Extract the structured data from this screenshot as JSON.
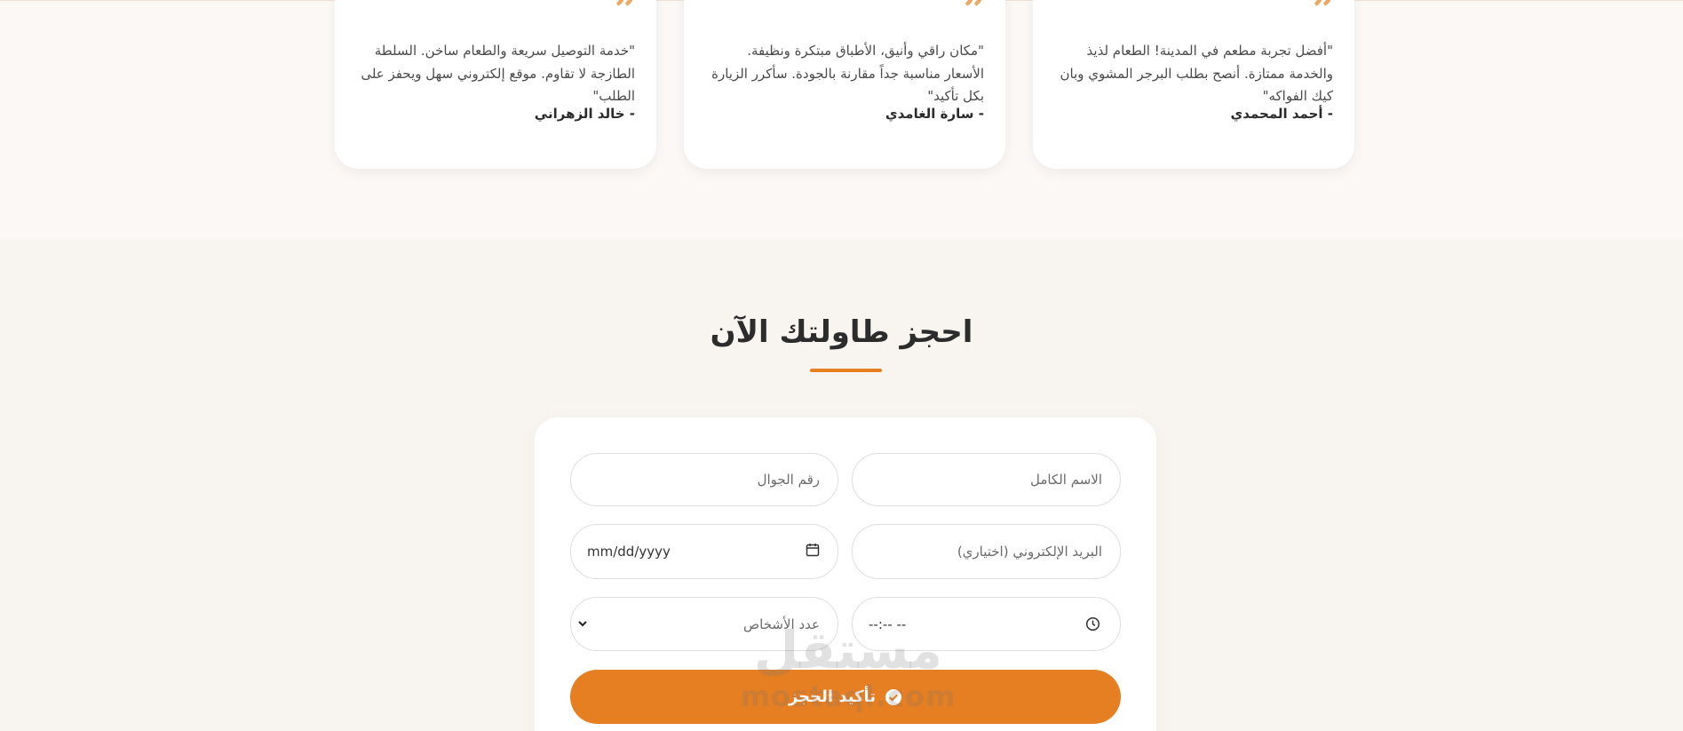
{
  "testimonials": [
    {
      "text": "\"أفضل تجربة مطعم في المدينة! الطعام لذيذ والخدمة ممتازة. أنصح بطلب البرجر المشوي وبان كيك الفواكه\"",
      "author": "- أحمد المحمدي"
    },
    {
      "text": "\"مكان راقي وأنيق، الأطباق مبتكرة ونظيفة. الأسعار مناسبة جداً مقارنة بالجودة. سأكرر الزيارة بكل تأكيد\"",
      "author": "- سارة الغامدي"
    },
    {
      "text": "\"خدمة التوصيل سريعة والطعام ساخن. السلطة الطازجة لا تقاوم. موقع إلكتروني سهل ويحفز على الطلب\"",
      "author": "- خالد الزهراني"
    }
  ],
  "booking": {
    "title": "احجز طاولتك الآن",
    "fields": {
      "full_name": "الاسم الكامل",
      "phone": "رقم الجوال",
      "email": "البريد الإلكتروني (اختياري)",
      "date": "mm/dd/yyyy",
      "time": "--:-- --",
      "people": "عدد الأشخاص"
    },
    "submit_label": "تأكيد الحجز"
  },
  "watermark": {
    "arabic": "مستقل",
    "latin": "mostaql.com"
  },
  "colors": {
    "accent": "#e67e22",
    "quote": "#e9a964",
    "background": "#f8f4ef"
  },
  "icons": {
    "quote": "quote-icon",
    "calendar": "calendar-icon",
    "clock": "clock-icon",
    "chevron": "chevron-down-icon",
    "check": "check-circle-icon"
  }
}
